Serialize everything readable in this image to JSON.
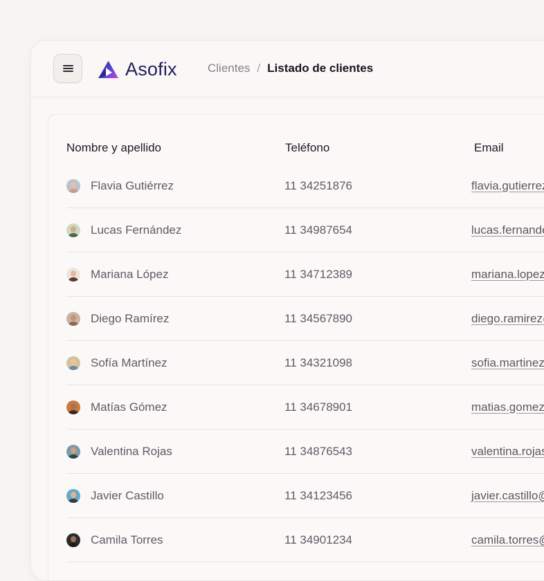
{
  "header": {
    "menu_icon": "menu-icon",
    "brand": {
      "name": "Asofix",
      "logo_icon": "asofix-triangle-logo",
      "colors": [
        "#2a2c86",
        "#6d4fd8",
        "#c23fd1"
      ]
    },
    "breadcrumb": {
      "parent": "Clientes",
      "separator": "/",
      "current": "Listado de clientes"
    }
  },
  "table": {
    "columns": {
      "name": "Nombre y apellido",
      "phone": "Teléfono",
      "email": "Email"
    },
    "rows": [
      {
        "name": "Flavia Gutiérrez",
        "phone": "11 34251876",
        "email": "flavia.gutierrez@",
        "avatar": {
          "bg": "#b9c3cf",
          "skin": "#e5c0a8",
          "shirt": "#c89f86"
        }
      },
      {
        "name": "Lucas Fernández",
        "phone": "11 34987654",
        "email": "lucas.fernandez@",
        "avatar": {
          "bg": "#cfd8c4",
          "skin": "#d7a985",
          "shirt": "#4a6a52"
        }
      },
      {
        "name": "Mariana López",
        "phone": "11 34712389",
        "email": "mariana.lopez@",
        "avatar": {
          "bg": "#ede6de",
          "skin": "#e4b899",
          "shirt": "#5a3c2e"
        }
      },
      {
        "name": "Diego Ramírez",
        "phone": "11 34567890",
        "email": "diego.ramirez@",
        "avatar": {
          "bg": "#cbb3a4",
          "skin": "#c59276",
          "shirt": "#8a6a5a"
        }
      },
      {
        "name": "Sofía Martínez",
        "phone": "11 34321098",
        "email": "sofia.martinez@",
        "avatar": {
          "bg": "#d6c29a",
          "skin": "#e8c4a6",
          "shirt": "#6e8aa0"
        }
      },
      {
        "name": "Matías Gómez",
        "phone": "11 34678901",
        "email": "matias.gomez@",
        "avatar": {
          "bg": "#c77b3c",
          "skin": "#a87256",
          "shirt": "#3a2a24"
        }
      },
      {
        "name": "Valentina Rojas",
        "phone": "11 34876543",
        "email": "valentina.rojas@",
        "avatar": {
          "bg": "#7f9aa6",
          "skin": "#caa189",
          "shirt": "#2f4650"
        }
      },
      {
        "name": "Javier Castillo",
        "phone": "11 34123456",
        "email": "javier.castillo@",
        "avatar": {
          "bg": "#67a9c8",
          "skin": "#e0b497",
          "shirt": "#3a3a3f"
        }
      },
      {
        "name": "Camila Torres",
        "phone": "11 34901234",
        "email": "camila.torres@",
        "avatar": {
          "bg": "#2d2a2c",
          "skin": "#9c6e58",
          "shirt": "#1c1a1b"
        }
      }
    ]
  }
}
